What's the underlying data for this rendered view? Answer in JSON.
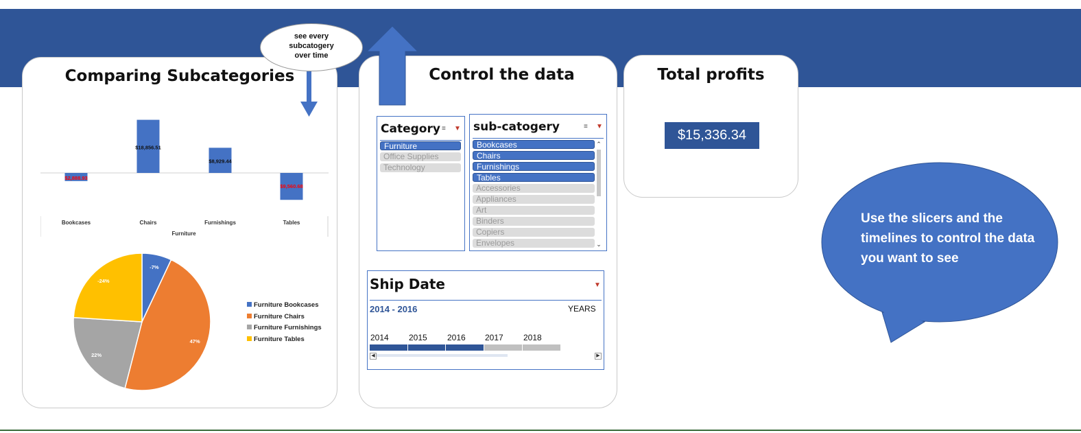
{
  "dashboard": {
    "compare": {
      "title": "Comparing Subcategories",
      "bubble": [
        "see every",
        "subcatogery",
        "over time"
      ]
    },
    "control": {
      "title": "Control the data"
    },
    "profits": {
      "title": "Total profits",
      "value": "$15,336.34"
    },
    "speech": "Use the slicers and the timelines to control the data you want to see"
  },
  "category_slicer": {
    "title": "Category",
    "items": [
      {
        "label": "Furniture",
        "selected": true
      },
      {
        "label": "Office Supplies",
        "selected": false
      },
      {
        "label": "Technology",
        "selected": false
      }
    ]
  },
  "subcategory_slicer": {
    "title": "sub-catogery",
    "items": [
      {
        "label": "Bookcases",
        "selected": true
      },
      {
        "label": "Chairs",
        "selected": true
      },
      {
        "label": "Furnishings",
        "selected": true
      },
      {
        "label": "Tables",
        "selected": true
      },
      {
        "label": "Accessories",
        "selected": false
      },
      {
        "label": "Appliances",
        "selected": false
      },
      {
        "label": "Art",
        "selected": false
      },
      {
        "label": "Binders",
        "selected": false
      },
      {
        "label": "Copiers",
        "selected": false
      },
      {
        "label": "Envelopes",
        "selected": false
      }
    ]
  },
  "timeline": {
    "title": "Ship Date",
    "range": "2014 - 2016",
    "level": "YEARS",
    "years": [
      "2014",
      "2015",
      "2016",
      "2017",
      "2018"
    ],
    "selected_years": [
      "2014",
      "2015",
      "2016"
    ]
  },
  "colors": {
    "banner": "#2f5597",
    "accent": "#4472c4",
    "bookcases": "#4472c4",
    "chairs": "#ed7d31",
    "furnishings": "#a5a5a5",
    "tables": "#ffc000",
    "negative_label": "#ff0000"
  },
  "chart_data": [
    {
      "type": "bar",
      "categories": [
        "Bookcases",
        "Chairs",
        "Furnishings",
        "Tables"
      ],
      "group_label": "Furniture",
      "values": [
        -2888.93,
        18856.51,
        8929.44,
        -9560.68
      ],
      "data_labels": [
        "$2,888.93",
        "$18,856.51",
        "$8,929.44",
        "$9,560.68"
      ],
      "ylim": [
        -10000,
        19000
      ]
    },
    {
      "type": "pie",
      "labels": [
        "Furniture Bookcases",
        "Furniture Chairs",
        "Furniture Furnishings",
        "Furniture Tables"
      ],
      "values": [
        7,
        47,
        22,
        24
      ],
      "data_labels": [
        "-7%",
        "47%",
        "22%",
        "-24%"
      ]
    }
  ]
}
